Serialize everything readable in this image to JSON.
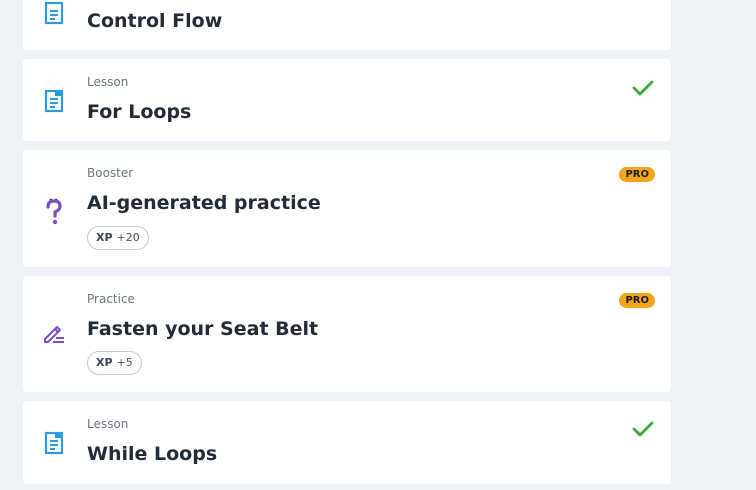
{
  "cards": [
    {
      "kind": "",
      "title": "Control Flow",
      "icon": "lesson-icon",
      "completed": false
    },
    {
      "kind": "Lesson",
      "title": "For Loops",
      "icon": "lesson-icon",
      "completed": true
    },
    {
      "kind": "Booster",
      "title": "AI-generated practice",
      "icon": "question-mark-icon",
      "badge": "PRO",
      "xp_label": "XP",
      "xp_value": "+20"
    },
    {
      "kind": "Practice",
      "title": "Fasten your Seat Belt",
      "icon": "pencil-icon",
      "badge": "PRO",
      "xp_label": "XP",
      "xp_value": "+5"
    },
    {
      "kind": "Lesson",
      "title": "While Loops",
      "icon": "lesson-icon",
      "completed": true
    }
  ],
  "colors": {
    "lesson_blue": "#2b9be0",
    "practice_purple": "#7b4fc9",
    "check_green": "#3aa935",
    "pro_orange": "#f3a51c",
    "background": "#eef2f6"
  }
}
